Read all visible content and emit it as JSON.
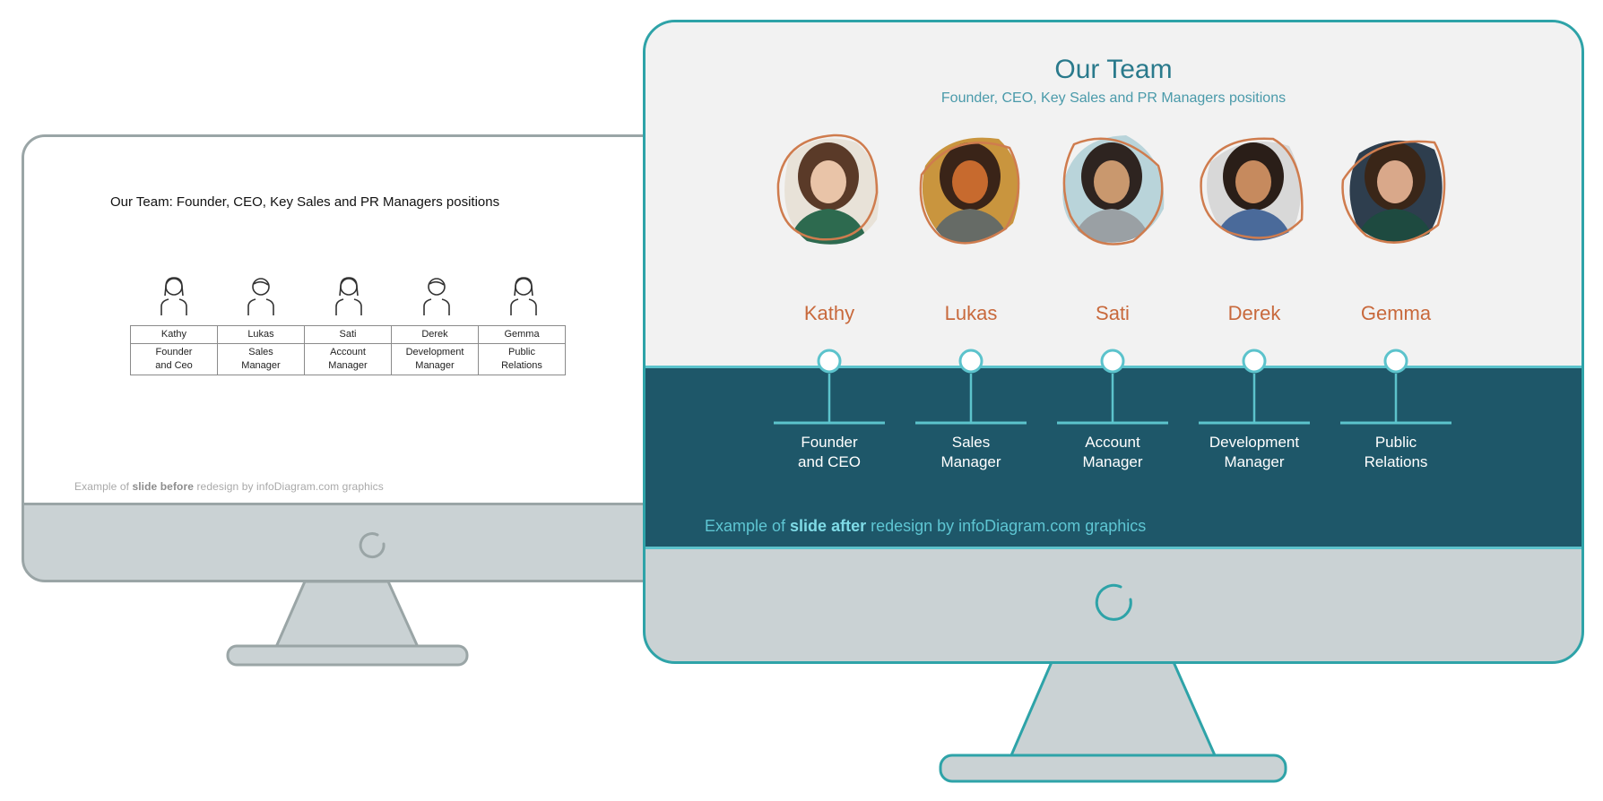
{
  "before_slide": {
    "title": "Our Team: Founder, CEO, Key Sales and PR Managers positions",
    "members": [
      {
        "name": "Kathy",
        "role_line1": "Founder",
        "role_line2": "and Ceo",
        "icon": "female-user-icon"
      },
      {
        "name": "Lukas",
        "role_line1": "Sales",
        "role_line2": "Manager",
        "icon": "male-user-icon"
      },
      {
        "name": "Sati",
        "role_line1": "Account",
        "role_line2": "Manager",
        "icon": "female-user-icon"
      },
      {
        "name": "Derek",
        "role_line1": "Development",
        "role_line2": "Manager",
        "icon": "male-user-icon"
      },
      {
        "name": "Gemma",
        "role_line1": "Public",
        "role_line2": "Relations",
        "icon": "female-user-icon"
      }
    ],
    "footer_prefix": "Example of ",
    "footer_bold": "slide before",
    "footer_suffix": " redesign by infoDiagram.com graphics"
  },
  "after_slide": {
    "title": "Our Team",
    "subtitle": "Founder, CEO, Key Sales and PR Managers positions",
    "members": [
      {
        "name": "Kathy",
        "role_line1": "Founder",
        "role_line2": "and CEO",
        "photo": "woman-curly-hair-photo"
      },
      {
        "name": "Lukas",
        "role_line1": "Sales",
        "role_line2": "Manager",
        "photo": "man-orange-jacket-photo"
      },
      {
        "name": "Sati",
        "role_line1": "Account",
        "role_line2": "Manager",
        "photo": "woman-glasses-photo"
      },
      {
        "name": "Derek",
        "role_line1": "Development",
        "role_line2": "Manager",
        "photo": "man-blue-shirt-photo"
      },
      {
        "name": "Gemma",
        "role_line1": "Public",
        "role_line2": "Relations",
        "photo": "woman-long-hair-photo"
      }
    ],
    "footer_prefix": "Example of ",
    "footer_bold": "slide after",
    "footer_suffix": " redesign by infoDiagram.com graphics"
  },
  "colors": {
    "teal_frame": "#2ea3a8",
    "gray_frame": "#9aa5a6",
    "bezel": "#cad2d4",
    "band": "#1e5769",
    "accent_line": "#5cc3cc",
    "name_orange": "#c8693c",
    "title_teal": "#2a7a8c"
  }
}
